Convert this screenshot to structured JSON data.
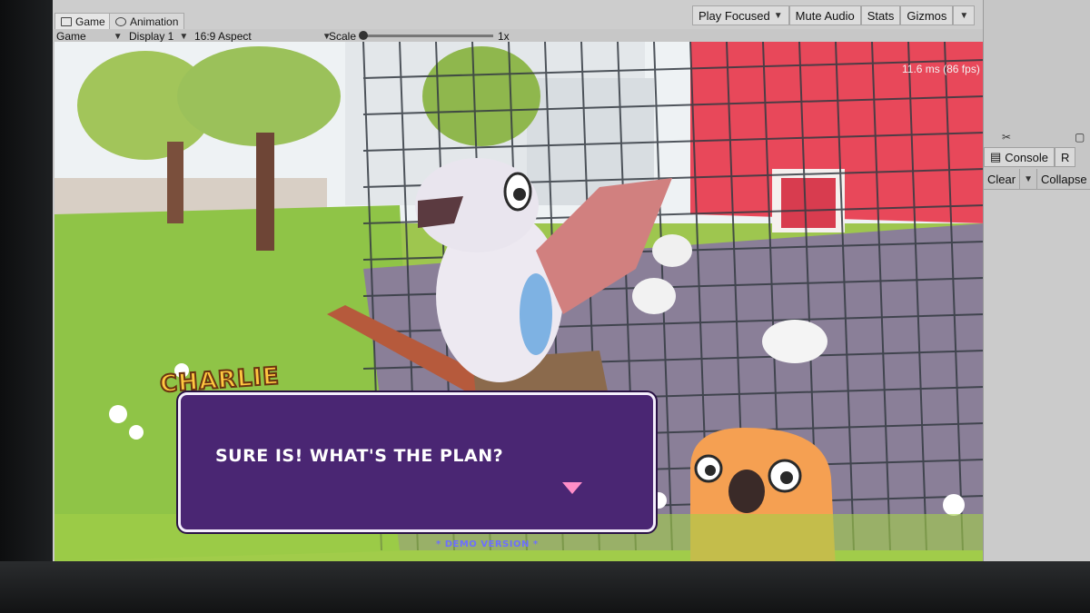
{
  "editor": {
    "tabs": [
      {
        "label": "Game"
      },
      {
        "label": "Animation"
      }
    ],
    "toolbar": {
      "play_focused": "Play Focused",
      "mute_audio": "Mute Audio",
      "stats": "Stats",
      "gizmos": "Gizmos"
    },
    "game_bar": {
      "view_mode": "Game",
      "display": "Display 1",
      "aspect": "16:9 Aspect",
      "scale_label": "Scale",
      "scale_value": "1x"
    },
    "fps_readout": "11.6 ms (86 fps)",
    "console": {
      "tab_label": "Console",
      "second_tab": "R",
      "clear": "Clear",
      "collapse": "Collapse"
    }
  },
  "game": {
    "speaker_name": "CHARLIE",
    "dialogue_text": "SURE IS! WHAT'S THE PLAN?",
    "demo_label": "* DEMO VERSION *"
  },
  "colors": {
    "dialogue_bg": "#4a2673",
    "speaker_name": "#ffc740",
    "barn_red": "#e8485a",
    "grass": "#9ec64f",
    "next_indicator": "#ff8ec8"
  }
}
